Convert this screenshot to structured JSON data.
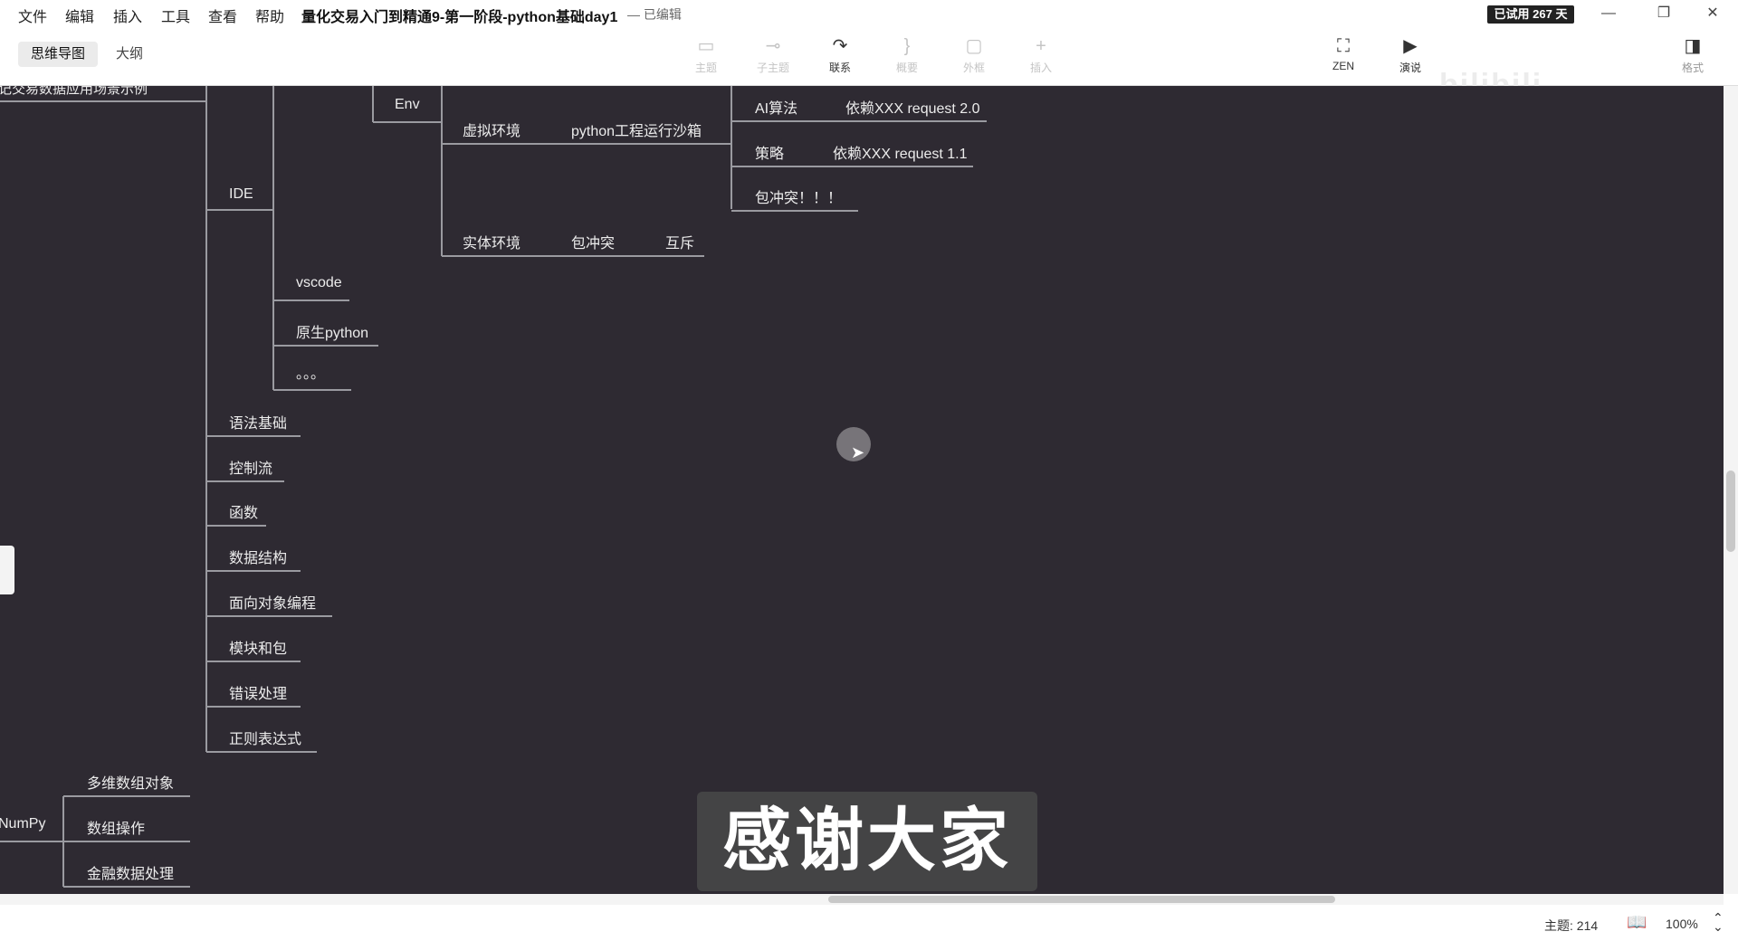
{
  "menu": [
    "文件",
    "编辑",
    "插入",
    "工具",
    "查看",
    "帮助"
  ],
  "document": {
    "title": "量化交易入门到精通9-第一阶段-python基础day1",
    "status": "— 已编辑"
  },
  "trial_badge": "已试用 267 天",
  "window_controls": {
    "minimize": "—",
    "restore": "❐",
    "close": "✕"
  },
  "view_tabs": {
    "mindmap": "思维导图",
    "outline": "大纲"
  },
  "tools": [
    {
      "label": "主题",
      "icon": "topic-icon",
      "enabled": false
    },
    {
      "label": "子主题",
      "icon": "subtopic-icon",
      "enabled": false
    },
    {
      "label": "联系",
      "icon": "relationship-icon",
      "enabled": true
    },
    {
      "label": "概要",
      "icon": "summary-icon",
      "enabled": false
    },
    {
      "label": "外框",
      "icon": "boundary-icon",
      "enabled": false
    },
    {
      "label": "插入",
      "icon": "insert-icon",
      "enabled": false
    },
    {
      "label": "ZEN",
      "icon": "zen-icon",
      "enabled": true
    },
    {
      "label": "演说",
      "icon": "pitch-icon",
      "enabled": true
    },
    {
      "label": "格式",
      "icon": "format-panel-icon",
      "enabled": true
    }
  ],
  "watermark": "bilibili",
  "mindmap": {
    "partial_top_node": "记交易数据应用场景示例",
    "ide": "IDE",
    "env": "Env",
    "virtual_env": "虚拟环境",
    "sandbox": "python工程运行沙箱",
    "ai_algo": "AI算法",
    "dep_20": "依赖XXX request 2.0",
    "strategy": "策略",
    "dep_11": "依赖XXX request 1.1",
    "conflict_bang": "包冲突！！！",
    "physical_env": "实体环境",
    "conflict": "包冲突",
    "mutex": "互斥",
    "vscode": "vscode",
    "native_python": "原生python",
    "ellipsis": "。。。",
    "topics": [
      "语法基础",
      "控制流",
      "函数",
      "数据结构",
      "面向对象编程",
      "模块和包",
      "错误处理",
      "正则表达式"
    ],
    "numpy": "NumPy",
    "numpy_children": [
      "多维数组对象",
      "数组操作",
      "金融数据处理"
    ]
  },
  "subtitle": "感谢大家",
  "status": {
    "topic_count": "主题: 214",
    "zoom": "100%"
  }
}
